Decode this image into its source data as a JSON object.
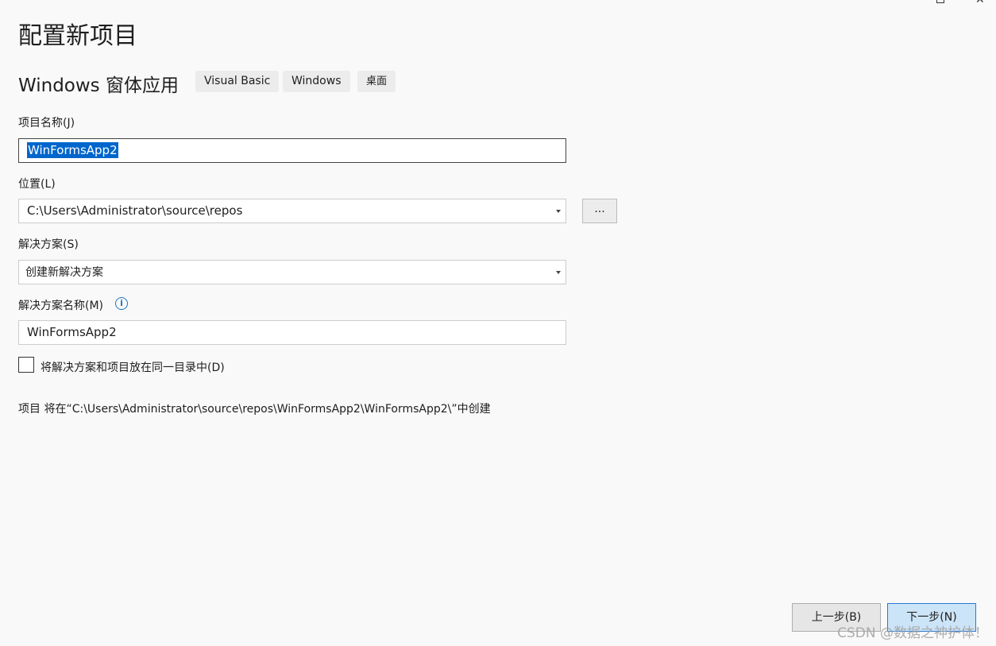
{
  "page_title": "配置新项目",
  "template": {
    "name": "Windows 窗体应用",
    "tags": [
      "Visual Basic",
      "Windows",
      "桌面"
    ]
  },
  "project_name": {
    "label": "项目名称(J)",
    "value": "WinFormsApp2"
  },
  "location": {
    "label": "位置(L)",
    "value": "C:\\Users\\Administrator\\source\\repos",
    "browse_label": "..."
  },
  "solution": {
    "label": "解决方案(S)",
    "value": "创建新解决方案"
  },
  "solution_name": {
    "label": "解决方案名称(M)",
    "value": "WinFormsApp2",
    "info_icon": "info-icon"
  },
  "same_dir": {
    "label": "将解决方案和项目放在同一目录中(D)",
    "checked": false
  },
  "summary": "项目 将在“C:\\Users\\Administrator\\source\\repos\\WinFormsApp2\\WinFormsApp2\\”中创建",
  "buttons": {
    "back": "上一步(B)",
    "next": "下一步(N)"
  },
  "watermark": "CSDN @数据之神护体！",
  "colors": {
    "selection": "#0066cc",
    "info_icon": "#1a73c7",
    "next_button_bg": "#cce4f7",
    "next_button_border": "#2a7ad4"
  }
}
